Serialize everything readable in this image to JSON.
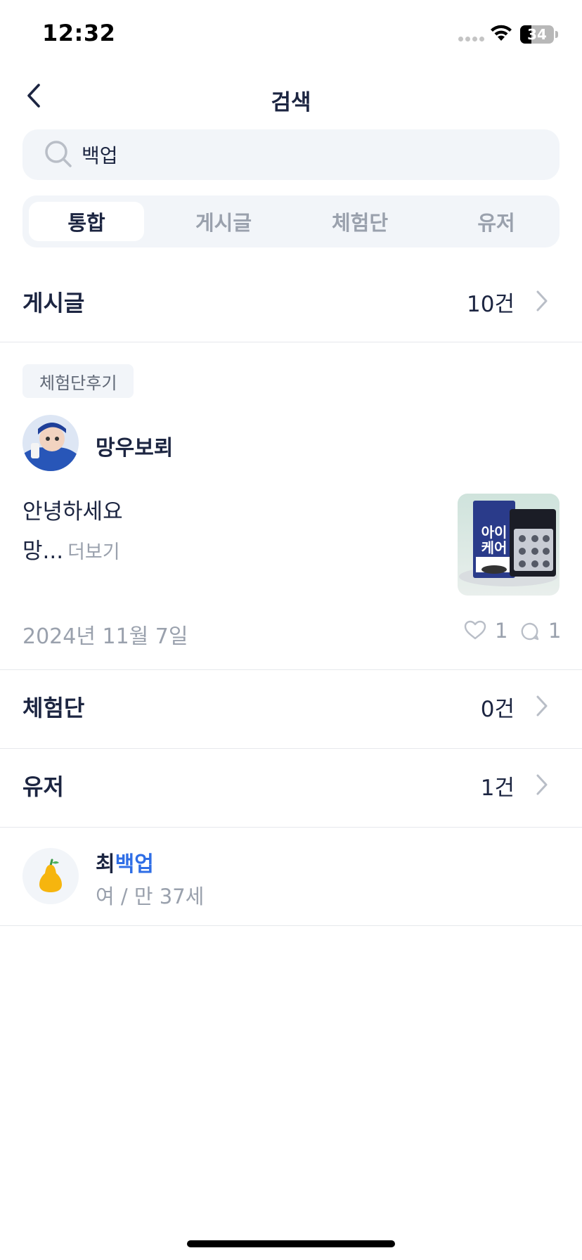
{
  "status_bar": {
    "time": "12:32",
    "battery": "34"
  },
  "header": {
    "title": "검색"
  },
  "search": {
    "value": "백업",
    "placeholder": ""
  },
  "tabs": [
    {
      "label": "통합",
      "active": true
    },
    {
      "label": "게시글",
      "active": false
    },
    {
      "label": "체험단",
      "active": false
    },
    {
      "label": "유저",
      "active": false
    }
  ],
  "posts_section": {
    "title": "게시글",
    "count": "10건"
  },
  "post": {
    "badge": "체험단후기",
    "author": "망우보뢰",
    "line1": "안녕하세요",
    "line2": "망...",
    "more": "더보기",
    "date": "2024년 11월 7일",
    "likes": "1",
    "comments": "1",
    "thumb_text": "아이케어"
  },
  "experience_section": {
    "title": "체험단",
    "count": "0건"
  },
  "users_section": {
    "title": "유저",
    "count": "1건"
  },
  "user": {
    "name_prefix": "최",
    "name_highlight": "백업",
    "meta": "여 / 만 37세"
  },
  "colors": {
    "primary_text": "#1c2541",
    "secondary_text": "#9aa1ad",
    "highlight": "#2f6ee6",
    "surface": "#f2f5f9"
  }
}
